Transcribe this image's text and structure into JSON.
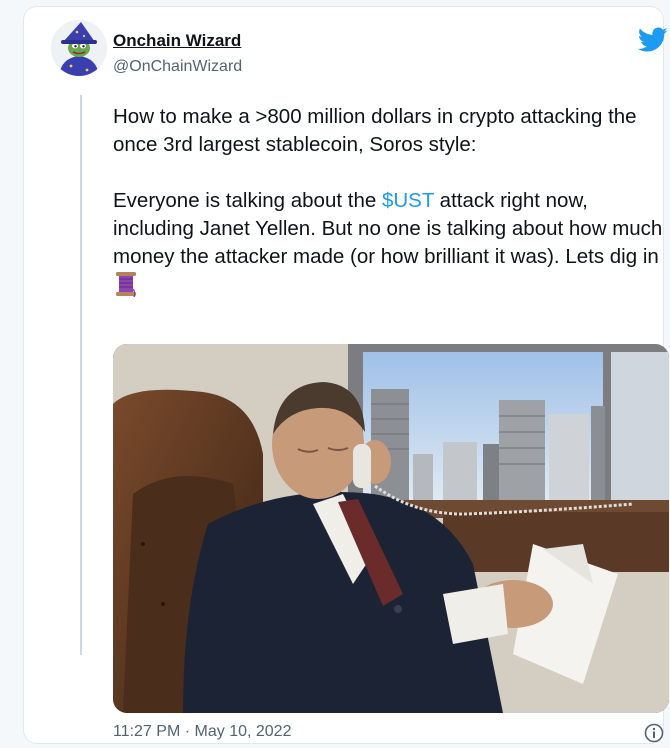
{
  "author": {
    "display_name": "Onchain Wizard",
    "handle": "@OnChainWizard"
  },
  "icons": {
    "platform": "twitter-bird-icon",
    "info": "info-icon",
    "thread": "thread-spool-icon"
  },
  "tweet": {
    "line1": "How to make a >800 million dollars in crypto attacking the once 3rd largest stablecoin, Soros style:",
    "p2_before": "Everyone is talking about the ",
    "cashtag": "$UST",
    "p2_after": " attack right now, including Janet Yellen. But no one is talking about how much money the attacker made (or how brilliant it was). Lets dig in"
  },
  "photo": {
    "phone_cord_text": "-"
  },
  "timestamp": {
    "time": "11:27 PM",
    "separator": " · ",
    "date": "May 10, 2022"
  },
  "colors": {
    "accent": "#1d9bf0",
    "text": "#0f1419",
    "muted": "#536471"
  }
}
